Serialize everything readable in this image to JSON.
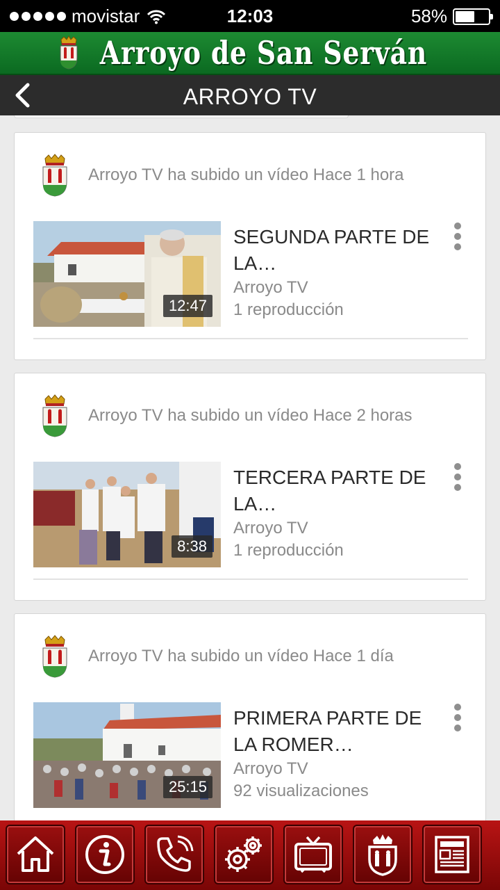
{
  "status_bar": {
    "carrier": "movistar",
    "time": "12:03",
    "battery_percent": "58%",
    "battery_level": 0.58,
    "signal_icon": "signal-dots-icon",
    "wifi_icon": "wifi-icon"
  },
  "header": {
    "title": "Arroyo de San Serván",
    "crest_icon": "coat-of-arms-icon"
  },
  "navbar": {
    "title": "ARROYO TV",
    "back_icon": "chevron-left-icon"
  },
  "colors": {
    "header_green": "#0b6a21",
    "navbar_dark": "#2c2c2c",
    "tabbar_red": "#9a0f0f"
  },
  "feed": [
    {
      "activity": "Arroyo TV ha subido un vídeo Hace 1 hora",
      "title": "SEGUNDA PARTE DE LA…",
      "channel": "Arroyo TV",
      "views": "1 reproducción",
      "duration": "12:47"
    },
    {
      "activity": "Arroyo TV ha subido un vídeo Hace 2 horas",
      "title": "TERCERA PARTE DE LA…",
      "channel": "Arroyo TV",
      "views": "1 reproducción",
      "duration": "8:38"
    },
    {
      "activity": "Arroyo TV ha subido un vídeo Hace 1 día",
      "title": "PRIMERA PARTE DE LA ROMER…",
      "channel": "Arroyo TV",
      "views": "92 visualizaciones",
      "duration": "25:15"
    }
  ],
  "tabbar": {
    "items": [
      {
        "icon": "home-icon"
      },
      {
        "icon": "info-icon"
      },
      {
        "icon": "phone-icon"
      },
      {
        "icon": "settings-gears-icon"
      },
      {
        "icon": "tv-icon"
      },
      {
        "icon": "coat-of-arms-icon"
      },
      {
        "icon": "newspaper-icon"
      }
    ]
  }
}
